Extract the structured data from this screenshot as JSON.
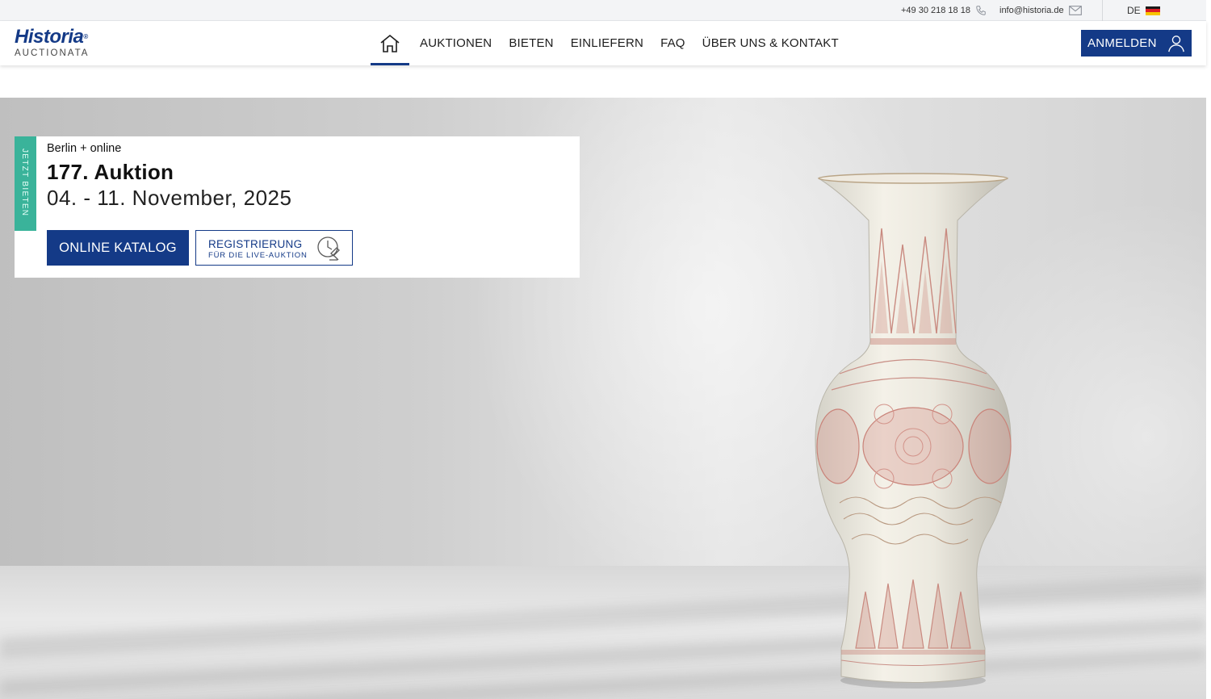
{
  "topbar": {
    "phone": "+49 30 218 18 18",
    "phone_icon": "phone-icon",
    "email": "info@historia.de",
    "email_icon": "envelope-icon",
    "language": "DE",
    "flag_icon": "german-flag-icon"
  },
  "header": {
    "logo_brand": "Historia",
    "logo_reg": "®",
    "logo_sub": "AUCTIONATA",
    "home_icon": "home-icon",
    "nav": [
      "AUKTIONEN",
      "BIETEN",
      "EINLIEFERN",
      "FAQ",
      "ÜBER UNS & KONTAKT"
    ],
    "login_label": "ANMELDEN",
    "login_icon": "user-icon"
  },
  "hero": {
    "tab_label": "JETZT BIETEN",
    "location": "Berlin + online",
    "title": "177. Auktion",
    "dates": "04. - 11. November, 2025",
    "catalog_button": "ONLINE KATALOG",
    "register_line1": "REGISTRIERUNG",
    "register_line2": "FÜR DIE LIVE-AUKTION",
    "register_icon": "clock-gavel-icon",
    "image": "porcelain-vase"
  },
  "colors": {
    "brand_blue": "#143a87",
    "accent_green": "#3ab39a"
  }
}
